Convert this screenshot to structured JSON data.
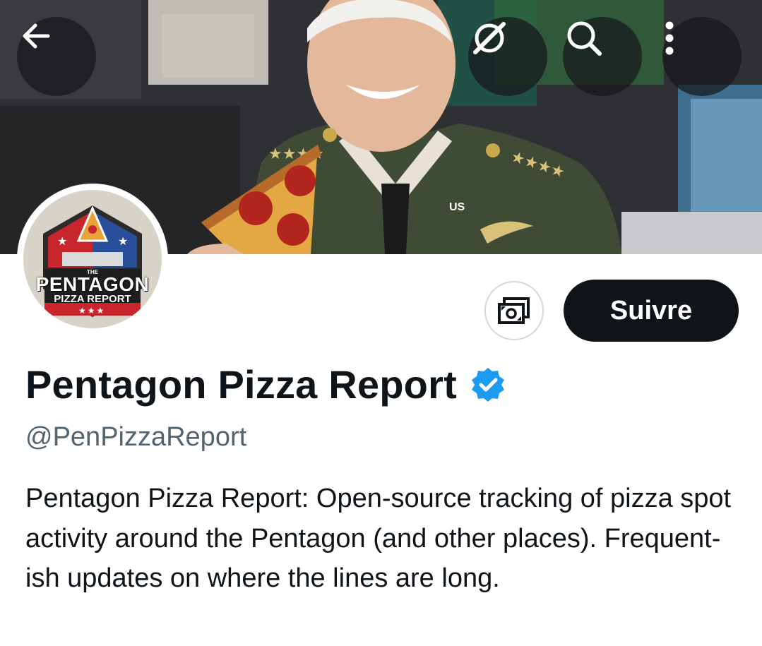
{
  "header": {
    "back_icon": "arrow-left-icon",
    "grok_icon": "grok-slash-icon",
    "search_icon": "search-icon",
    "more_icon": "more-vertical-icon"
  },
  "banner": {
    "shoulder_tag": "US"
  },
  "avatar": {
    "small_text": "THE",
    "line1": "PENTAGON",
    "line2": "PIZZA REPORT",
    "stars": "★★★"
  },
  "actions": {
    "tip_icon": "money-icon",
    "follow_label": "Suivre"
  },
  "profile": {
    "display_name": "Pentagon Pizza Report",
    "handle": "@PenPizzaReport",
    "bio": "Pentagon Pizza Report: Open-source tracking of pizza spot activity around the Pentagon (and other places). Frequent-ish updates on where the lines are long."
  },
  "colors": {
    "accent_verified": "#1d9bf0",
    "follow_bg": "#0f1419",
    "handle_gray": "#536471"
  }
}
